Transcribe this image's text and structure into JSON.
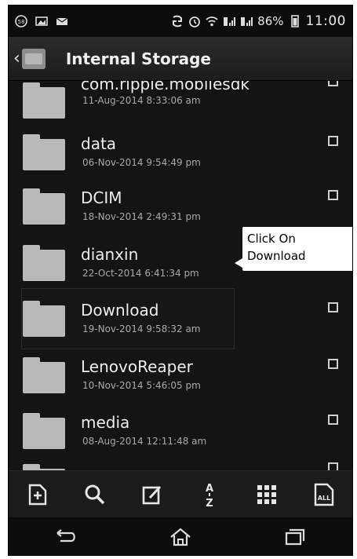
{
  "status_bar": {
    "battery": "86%",
    "time": "11:00"
  },
  "app_bar": {
    "title": "Internal Storage"
  },
  "files": [
    {
      "name": "com.ripple.mobilesdk",
      "date": "11-Aug-2014 8:33:06 am"
    },
    {
      "name": "data",
      "date": "06-Nov-2014 9:54:49 pm"
    },
    {
      "name": "DCIM",
      "date": "18-Nov-2014 2:49:31 pm"
    },
    {
      "name": "dianxin",
      "date": "22-Oct-2014 6:41:34 pm"
    },
    {
      "name": "Download",
      "date": "19-Nov-2014 9:58:32 am"
    },
    {
      "name": "LenovoReaper",
      "date": "10-Nov-2014 5:46:05 pm"
    },
    {
      "name": "media",
      "date": "08-Aug-2014 12:11:48 am"
    }
  ],
  "callout": {
    "line1": "Click On",
    "line2": "Download"
  },
  "toolbar": {
    "icons": [
      "new-file-icon",
      "search-icon",
      "rename-icon",
      "sort-az-icon",
      "grid-view-icon",
      "select-all-icon"
    ],
    "sort_label": "A Z",
    "select_all_label": "ALL"
  },
  "nav": {
    "icons": [
      "back-icon",
      "home-icon",
      "recents-icon"
    ]
  }
}
